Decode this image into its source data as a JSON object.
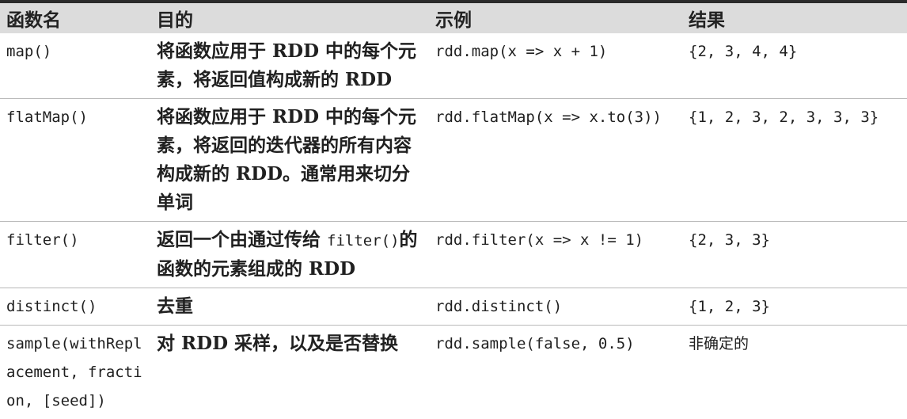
{
  "headers": {
    "func": "函数名",
    "purpose": "目的",
    "example": "示例",
    "result": "结果"
  },
  "rows": [
    {
      "func": "map()",
      "purpose": "将函数应用于 RDD 中的每个元素，将返回值构成新的 RDD",
      "example": "rdd.map(x => x + 1)",
      "result": "{2, 3, 4, 4}"
    },
    {
      "func": "flatMap()",
      "purpose": "将函数应用于 RDD 中的每个元素，将返回的迭代器的所有内容构成新的 RDD。通常用来切分单词",
      "example": "rdd.flatMap(x => x.to(3))",
      "result": "{1, 2, 3, 2, 3, 3, 3}"
    },
    {
      "func": "filter()",
      "purpose_pre": "返回一个由通过传给",
      "purpose_code": "filter()",
      "purpose_post": "的函数的元素组成的 RDD",
      "example": "rdd.filter(x => x != 1)",
      "result": "{2, 3, 3}"
    },
    {
      "func": "distinct()",
      "purpose": "去重",
      "example": "rdd.distinct()",
      "result": "{1, 2, 3}"
    },
    {
      "func": "sample(withReplacement, fraction, [seed])",
      "purpose": "对 RDD 采样，以及是否替换",
      "example": "rdd.sample(false, 0.5)",
      "result": "非确定的"
    }
  ]
}
